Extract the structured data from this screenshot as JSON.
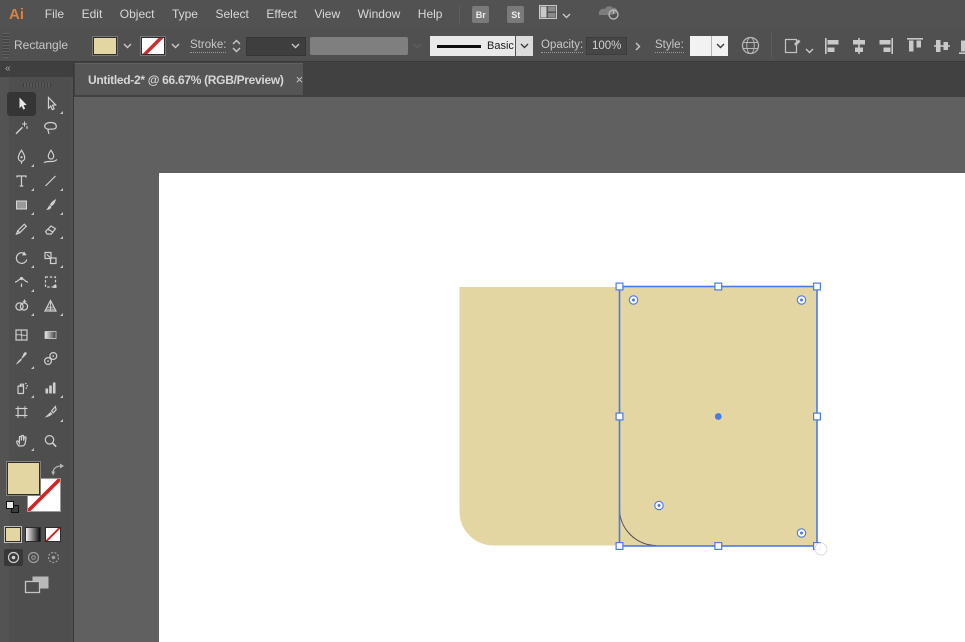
{
  "menu_bar": {
    "logo": "Ai",
    "items": [
      "File",
      "Edit",
      "Object",
      "Type",
      "Select",
      "Effect",
      "View",
      "Window",
      "Help"
    ],
    "bridge_label": "Br",
    "stock_label": "St"
  },
  "control_bar": {
    "selection_type_label": "Rectangle",
    "stroke_label": "Stroke:",
    "stroke_style_value": "Basic",
    "opacity_label": "Opacity:",
    "opacity_value": "100%",
    "style_label": "Style:",
    "align_tools": [
      "align-horizontal-left",
      "align-horizontal-center",
      "align-horizontal-right",
      "align-vertical-top",
      "align-vertical-center",
      "align-vertical-bottom"
    ]
  },
  "tab": {
    "title": "Untitled-2* @ 66.67% (RGB/Preview)",
    "close_glyph": "×"
  },
  "toolbar": {
    "collapse_glyph": "«",
    "tool_groups": [
      [
        "selection",
        "direct-selection",
        "magic-wand",
        "lasso"
      ],
      [
        "pen",
        "curvature",
        "type",
        "line-segment",
        "rectangle",
        "paintbrush",
        "shaper",
        "eraser"
      ],
      [
        "rotate",
        "scale",
        "width",
        "free-transform",
        "shape-builder",
        "perspective-grid"
      ],
      [
        "mesh",
        "gradient",
        "eyedropper",
        "blend"
      ],
      [
        "symbol-sprayer",
        "column-graph",
        "artboard",
        "slice"
      ],
      [
        "hand",
        "zoom"
      ]
    ],
    "active_tool": "selection",
    "fill_color": "#e3d6a2",
    "stroke_value": "none"
  },
  "canvas": {
    "shape_fill_color": "#e3d6a2",
    "selection_color": "#4a79e8"
  }
}
